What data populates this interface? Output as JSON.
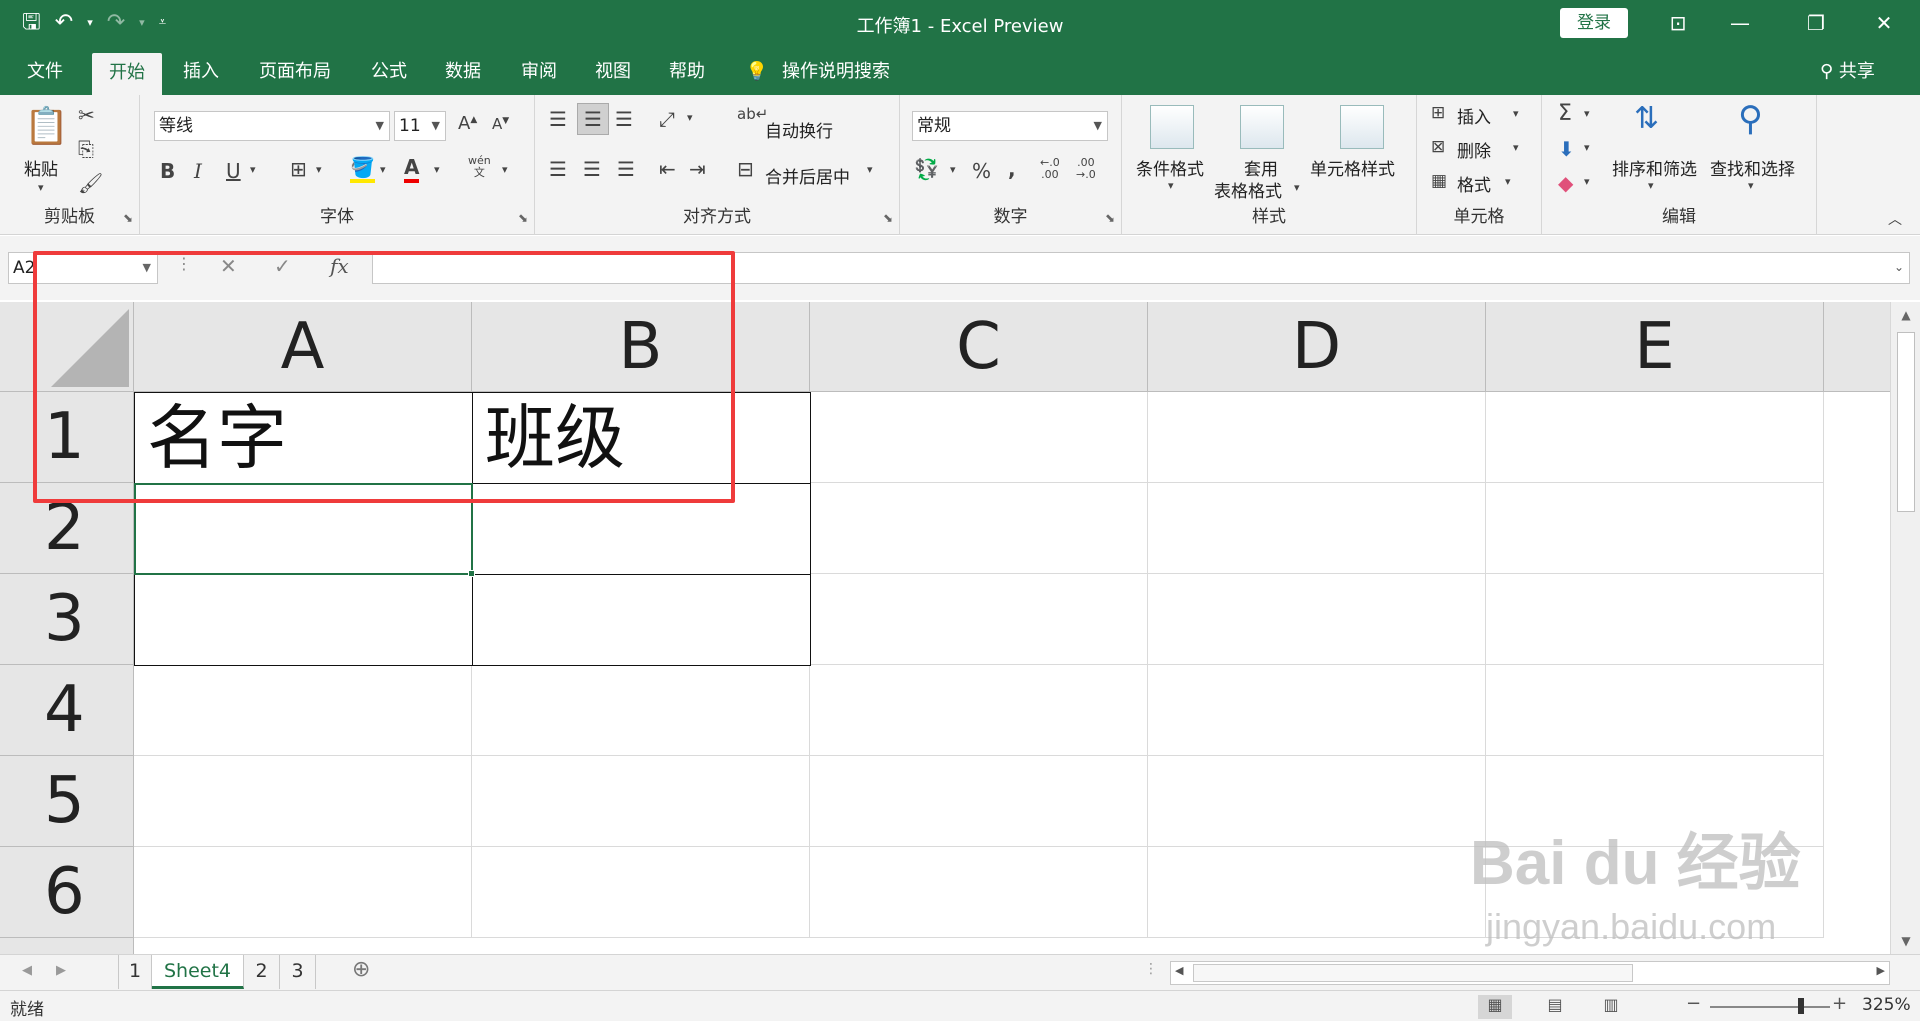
{
  "app": {
    "title": "工作簿1  -  Excel Preview",
    "login_label": "登录",
    "share_label": "共享",
    "accent": "#217346",
    "annotation_color": "#ef3b3b"
  },
  "tabs": [
    "文件",
    "开始",
    "插入",
    "页面布局",
    "公式",
    "数据",
    "审阅",
    "视图",
    "帮助"
  ],
  "tell_me": "操作说明搜索",
  "ribbon": {
    "clipboard": {
      "label": "剪贴板",
      "paste": "粘贴"
    },
    "font": {
      "label": "字体",
      "name": "等线",
      "size": "11",
      "bold": "B",
      "italic": "I",
      "underline": "U",
      "font_color_letter": "A",
      "phonetic": "wén"
    },
    "alignment": {
      "label": "对齐方式",
      "wrap": "自动换行",
      "merge": "合并后居中"
    },
    "number": {
      "label": "数字",
      "format": "常规",
      "percent": "%",
      "comma": ",",
      "inc_decimal": "←.0\n.00",
      "dec_decimal": ".00\n→.0"
    },
    "styles": {
      "label": "样式",
      "conditional": "条件格式",
      "table_1": "套用",
      "table_2": "表格格式",
      "cell_styles": "单元格样式"
    },
    "cells": {
      "label": "单元格",
      "insert": "插入",
      "delete": "删除",
      "format": "格式"
    },
    "editing": {
      "label": "编辑",
      "sort_filter": "排序和筛选",
      "find_select": "查找和选择"
    }
  },
  "formula_bar": {
    "name_box": "A2",
    "fx": "fx",
    "value": ""
  },
  "grid": {
    "columns": [
      "A",
      "B",
      "C",
      "D",
      "E"
    ],
    "rows": [
      "1",
      "2",
      "3",
      "4",
      "5",
      "6"
    ],
    "cells": {
      "A1": "名字",
      "B1": "班级"
    },
    "active_cell": "A2"
  },
  "sheets": {
    "tabs": [
      "1",
      "Sheet4",
      "2",
      "3"
    ],
    "active": "Sheet4"
  },
  "status": {
    "ready": "就绪",
    "zoom": "325%"
  },
  "watermark": {
    "logo": "Bai du 经验",
    "url": "jingyan.baidu.com"
  }
}
